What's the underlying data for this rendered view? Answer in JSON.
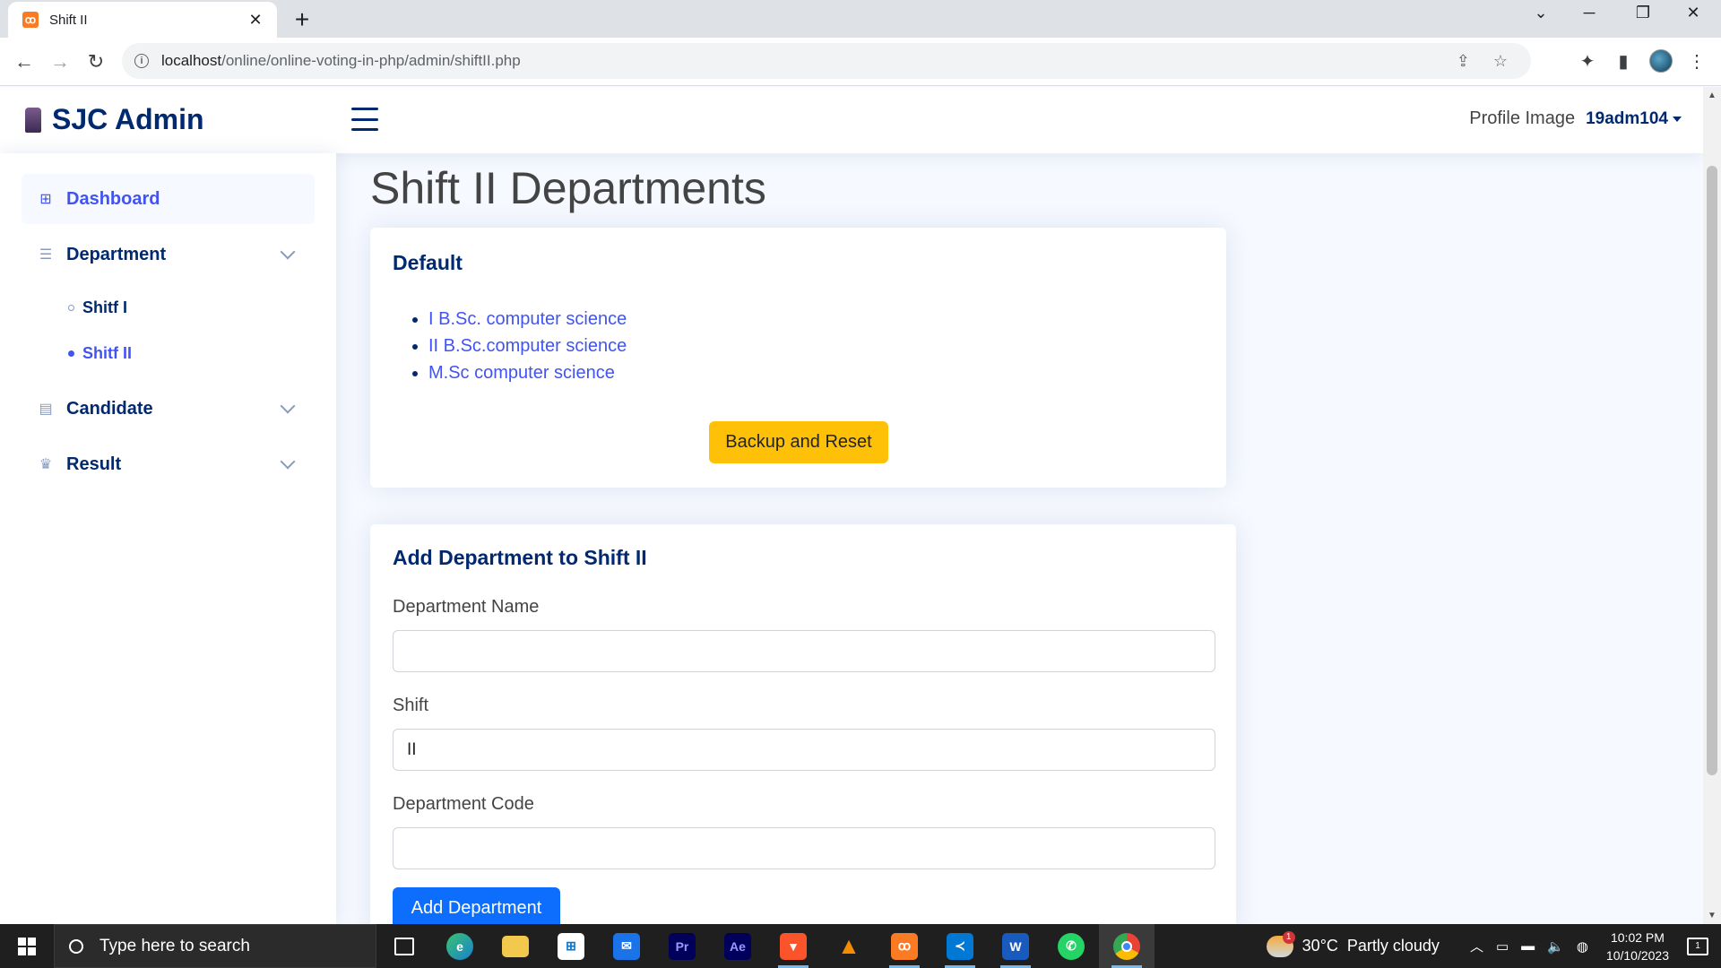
{
  "browser": {
    "tab_title": "Shift II",
    "tab_favicon": "xampp-icon",
    "url_host": "localhost",
    "url_path": "/online/online-voting-in-php/admin/shiftII.php"
  },
  "header": {
    "brand": "SJC Admin",
    "profile_image_alt": "Profile Image",
    "username": "19adm104"
  },
  "sidebar": {
    "items": [
      {
        "label": "Dashboard",
        "icon": "grid-icon"
      },
      {
        "label": "Department",
        "icon": "layout-icon"
      },
      {
        "label": "Candidate",
        "icon": "journal-icon"
      },
      {
        "label": "Result",
        "icon": "trophy-icon"
      }
    ],
    "department_sub": [
      {
        "label": "Shitf I"
      },
      {
        "label": "Shitf II"
      }
    ]
  },
  "main": {
    "title": "Shift II Departments",
    "default_card": {
      "title": "Default",
      "departments": [
        "I B.Sc. computer science",
        "II B.Sc.computer science",
        "M.Sc computer science"
      ],
      "reset_button": "Backup and Reset"
    },
    "add_card": {
      "title": "Add Department to Shift II",
      "name_label": "Department Name",
      "name_value": "",
      "shift_label": "Shift",
      "shift_value": "II",
      "code_label": "Department Code",
      "code_value": "",
      "submit_button": "Add Department"
    }
  },
  "taskbar": {
    "search_placeholder": "Type here to search",
    "weather_temp": "30°C",
    "weather_desc": "Partly cloudy",
    "time": "10:02 PM",
    "date": "10/10/2023",
    "notification_count": "1",
    "weather_badge": "1"
  },
  "colors": {
    "brand_navy": "#012970",
    "accent_blue": "#4154f1",
    "warning": "#ffc107",
    "primary": "#0d6efd"
  }
}
